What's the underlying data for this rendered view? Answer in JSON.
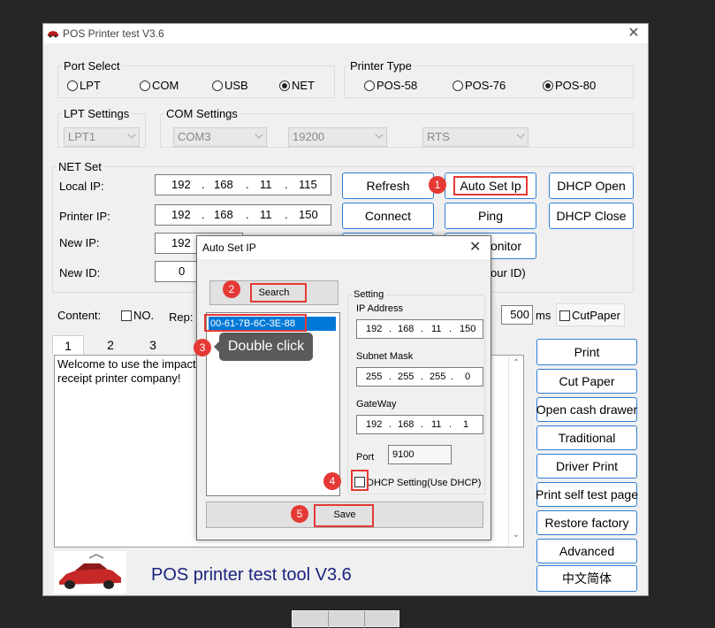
{
  "window": {
    "title": "POS Printer test V3.6",
    "close": "✕"
  },
  "port_select": {
    "legend": "Port Select",
    "options": [
      {
        "label": "LPT",
        "selected": false
      },
      {
        "label": "COM",
        "selected": false
      },
      {
        "label": "USB",
        "selected": false
      },
      {
        "label": "NET",
        "selected": true
      }
    ]
  },
  "printer_type": {
    "legend": "Printer Type",
    "options": [
      {
        "label": "POS-58",
        "selected": false
      },
      {
        "label": "POS-76",
        "selected": false
      },
      {
        "label": "POS-80",
        "selected": true
      }
    ]
  },
  "lpt_settings": {
    "legend": "LPT Settings",
    "value": "LPT1"
  },
  "com_settings": {
    "legend": "COM Settings",
    "port": "COM3",
    "baud": "19200",
    "flow": "RTS"
  },
  "net_set": {
    "legend": "NET Set",
    "local_ip_label": "Local IP:",
    "local_ip": [
      "192",
      "168",
      "11",
      "115"
    ],
    "printer_ip_label": "Printer IP:",
    "printer_ip": [
      "192",
      "168",
      "11",
      "150"
    ],
    "new_ip_label": "New IP:",
    "new_ip_first": "192",
    "new_id_label": "New ID:",
    "new_id_value": "0",
    "id_hint_partial": "our ID)"
  },
  "buttons": {
    "refresh": "Refresh",
    "auto_set_ip": "Auto Set Ip",
    "dhcp_open": "DHCP Open",
    "connect": "Connect",
    "ping": "Ping",
    "dhcp_close": "DHCP Close",
    "monitor_partial": "onitor"
  },
  "content_row": {
    "content_label": "Content:",
    "no_label": "NO.",
    "rep_label": "Rep:",
    "ms_value": "500",
    "ms_label": "ms",
    "cut_paper_label": "CutPaper"
  },
  "tabs": [
    "1",
    "2",
    "3"
  ],
  "text_area": "Welcome to use the impact\nreceipt printer company!",
  "right_buttons": [
    "Print",
    "Cut Paper",
    "Open cash drawer",
    "Traditional",
    "Driver Print",
    "Print self test page",
    "Restore factory",
    "Advanced",
    "中文简体"
  ],
  "footer": {
    "title": "POS printer test tool V3.6"
  },
  "dialog": {
    "title": "Auto Set IP",
    "close": "✕",
    "search_label": "Search",
    "list_items": [
      "00-61-7B-6C-3E-88"
    ],
    "setting_legend": "Setting",
    "ip_address_label": "IP Address",
    "ip_address": [
      "192",
      "168",
      "11",
      "150"
    ],
    "subnet_label": "Subnet Mask",
    "subnet": [
      "255",
      "255",
      "255",
      "0"
    ],
    "gateway_label": "GateWay",
    "gateway": [
      "192",
      "168",
      "11",
      "1"
    ],
    "port_label": "Port",
    "port_value": "9100",
    "dhcp_label": "DHCP Setting(Use DHCP)",
    "save_label": "Save"
  },
  "annotations": {
    "badges": [
      "1",
      "2",
      "3",
      "4",
      "5"
    ],
    "tooltip": "Double click"
  },
  "colors": {
    "highlight": "#e53935",
    "selection": "#0078d7",
    "accent_border": "#2f7fd6",
    "footer_title": "#1a237e"
  }
}
